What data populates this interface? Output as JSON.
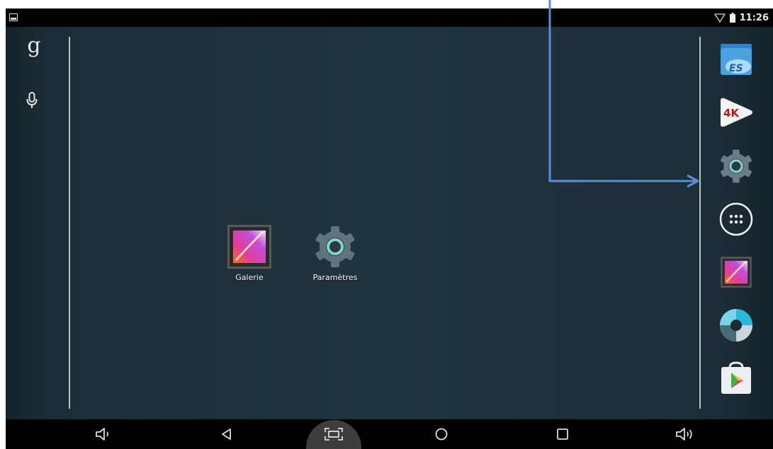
{
  "statusbar": {
    "time": "11:26",
    "icons": [
      "image-icon",
      "wifi-icon",
      "battery-icon"
    ]
  },
  "search": {
    "google_glyph": "g",
    "icons": [
      "google-icon",
      "microphone-icon"
    ]
  },
  "desktop_apps": [
    {
      "label": "Galerie",
      "icon": "gallery-icon"
    },
    {
      "label": "Paramètres",
      "icon": "settings-icon"
    }
  ],
  "dock": [
    {
      "icon": "es-file-explorer-icon",
      "text": "ES"
    },
    {
      "icon": "4k-player-icon",
      "text": "4K"
    },
    {
      "icon": "settings-icon"
    },
    {
      "icon": "app-drawer-icon"
    },
    {
      "icon": "gallery-icon"
    },
    {
      "icon": "camera-icon"
    },
    {
      "icon": "play-store-icon"
    }
  ],
  "navbar": [
    "volume-down-icon",
    "back-icon",
    "screenshot-icon",
    "home-icon",
    "recents-icon",
    "volume-up-icon"
  ],
  "colors": {
    "wallpaper": "#1e2f3a",
    "annotation_arrow": "#5b8fd0",
    "settings_teal": "#7fd6d0"
  }
}
